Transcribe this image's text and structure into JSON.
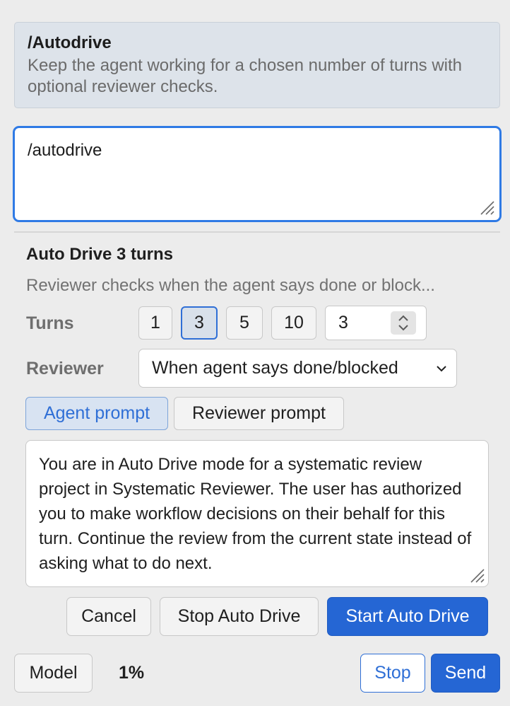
{
  "command_info": {
    "title": "/Autodrive",
    "description": "Keep the agent working for a chosen number of turns with optional reviewer checks."
  },
  "command_input": {
    "value": "/autodrive"
  },
  "auto_drive": {
    "title": "Auto Drive 3 turns",
    "description": "Reviewer checks when the agent says done or block...",
    "turns_label": "Turns",
    "turn_options": [
      "1",
      "3",
      "5",
      "10"
    ],
    "selected_turns": "3",
    "turns_input_value": "3",
    "reviewer_label": "Reviewer",
    "reviewer_selected": "When agent says done/blocked",
    "tabs": {
      "agent": "Agent prompt",
      "reviewer": "Reviewer prompt",
      "active": "agent"
    },
    "prompt_text": "You are in Auto Drive mode for a systematic review project in Systematic Reviewer. The user has authorized you to make workflow decisions on their behalf for this turn. Continue the review from the current state instead of asking what to do next.",
    "buttons": {
      "cancel": "Cancel",
      "stop": "Stop Auto Drive",
      "start": "Start Auto Drive"
    }
  },
  "footer": {
    "model_label": "Model",
    "usage": "1%",
    "stop_label": "Stop",
    "send_label": "Send"
  },
  "colors": {
    "accent": "#2566d4",
    "focus_border": "#2f7ae5",
    "info_card_bg": "#dde3ea"
  },
  "icons": [
    "resize-grip-icon",
    "stepper-arrows-icon",
    "chevron-down-icon"
  ]
}
